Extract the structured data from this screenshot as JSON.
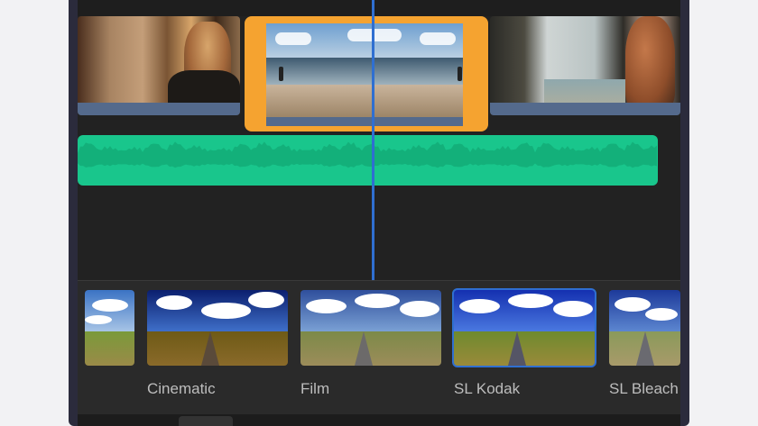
{
  "editor": {
    "playhead": {
      "position_fraction": 0.49
    },
    "video_track": {
      "clips": [
        {
          "name": "clip-woman-beach-1",
          "selected": false
        },
        {
          "name": "clip-beach-ocean",
          "selected": true,
          "accent": "#f5a330"
        },
        {
          "name": "clip-woman-phone",
          "selected": false
        }
      ]
    },
    "audio_track": {
      "color": "#19c68c"
    }
  },
  "filters": {
    "selected_index": 3,
    "accent": "#2f6fd1",
    "items": [
      {
        "label": ""
      },
      {
        "label": "Cinematic"
      },
      {
        "label": "Film"
      },
      {
        "label": "SL Kodak"
      },
      {
        "label": "SL Bleach"
      }
    ]
  }
}
